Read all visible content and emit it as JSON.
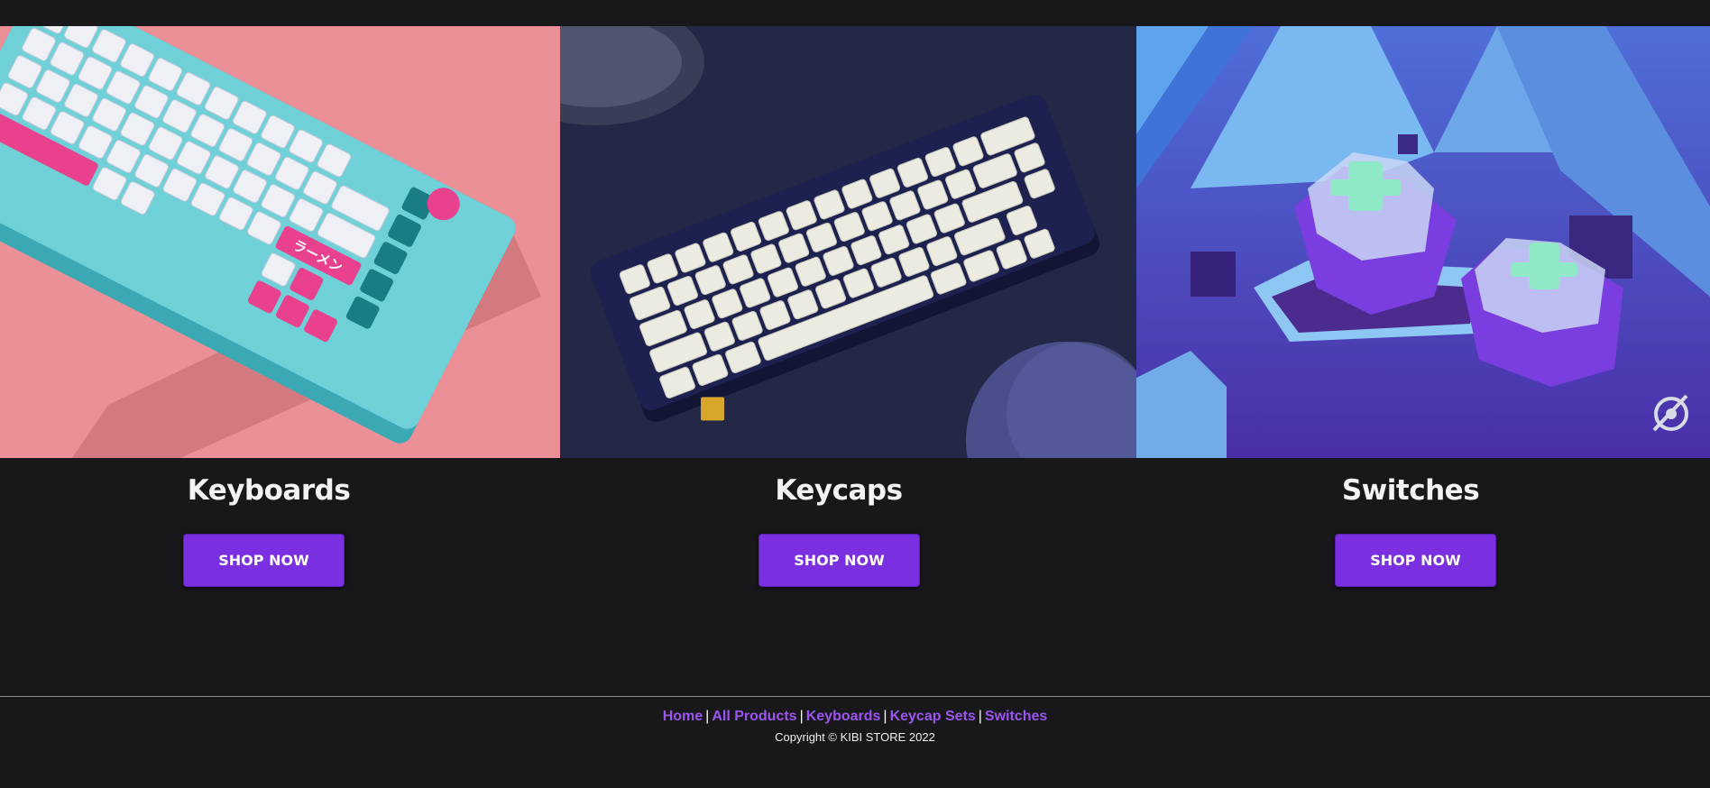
{
  "categories": [
    {
      "title": "Keyboards",
      "button": "SHOP NOW",
      "image": "keyboard-photo"
    },
    {
      "title": "Keycaps",
      "button": "SHOP NOW",
      "image": "keycaps-photo"
    },
    {
      "title": "Switches",
      "button": "SHOP NOW",
      "image": "switches-photo"
    }
  ],
  "keyboard_accent_label": "ラーメン",
  "footer": {
    "links": [
      "Home",
      "All Products",
      "Keyboards",
      "Keycap Sets",
      "Switches"
    ],
    "copyright": "Copyright © KIBI STORE 2022"
  },
  "colors": {
    "background": "#18181a",
    "accent": "#7a2fe0",
    "link": "#9b55f0"
  }
}
